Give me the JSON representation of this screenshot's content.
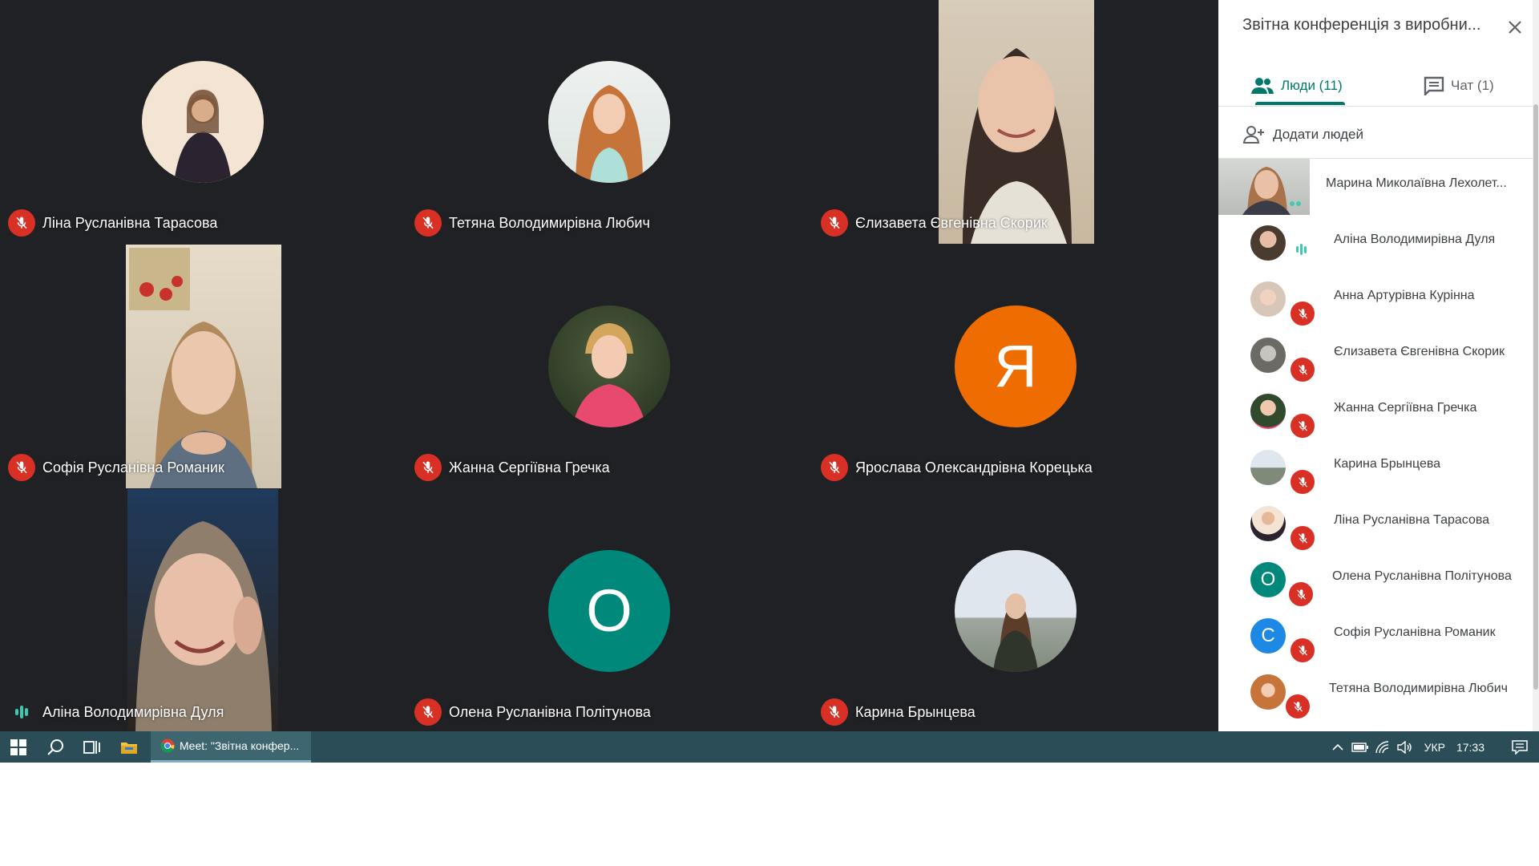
{
  "colors": {
    "meet_bg": "#202124",
    "mic_off_red": "#d93025",
    "accent_teal": "#00796b",
    "speaking_teal": "#3ec9b0",
    "avatar_orange": "#ef6c00",
    "avatar_green": "#00897b",
    "avatar_blue": "#1e88e5",
    "taskbar": "#2a4d57"
  },
  "tiles": [
    {
      "name": "Ліна Русланівна Тарасова",
      "mic": "off",
      "display": "photo"
    },
    {
      "name": "Тетяна Володимирівна Любич",
      "mic": "off",
      "display": "photo"
    },
    {
      "name": "Єлизавета Євгенівна Скорик",
      "mic": "off",
      "display": "video"
    },
    {
      "name": "Софія Русланівна Романик",
      "mic": "off",
      "display": "video"
    },
    {
      "name": "Жанна Сергіївна Гречка",
      "mic": "off",
      "display": "photo"
    },
    {
      "name": "Ярослава Олександрівна Корецька",
      "mic": "off",
      "display": "letter",
      "letter": "Я"
    },
    {
      "name": "Аліна Володимирівна Дуля",
      "mic": "speaking",
      "display": "video"
    },
    {
      "name": "Олена Русланівна Політунова",
      "mic": "off",
      "display": "letter",
      "letter": "О"
    },
    {
      "name": "Карина Брынцева",
      "mic": "off",
      "display": "photo"
    }
  ],
  "panel": {
    "title": "Звітна конференція з виробни...",
    "close_icon": "close-icon",
    "tabs": [
      {
        "label": "Люди (11)",
        "icon": "people-icon",
        "active": true
      },
      {
        "label": "Чат (1)",
        "icon": "chat-icon",
        "active": false
      }
    ],
    "add_people_label": "Додати людей",
    "participants": [
      {
        "name": "Марина Миколаївна Лехолет...",
        "status": "presenting-video"
      },
      {
        "name": "Аліна Володимирівна Дуля",
        "status": "speaking"
      },
      {
        "name": "Анна Артурівна Курінна",
        "status": "muted"
      },
      {
        "name": "Єлизавета Євгенівна Скорик",
        "status": "muted"
      },
      {
        "name": "Жанна Сергіївна Гречка",
        "status": "muted"
      },
      {
        "name": "Карина Брынцева",
        "status": "muted"
      },
      {
        "name": "Ліна Русланівна Тарасова",
        "status": "muted"
      },
      {
        "name": "Олена Русланівна Політунова",
        "status": "muted",
        "letter": "О"
      },
      {
        "name": "Софія Русланівна Романик",
        "status": "muted",
        "letter": "С"
      },
      {
        "name": "Тетяна Володимирівна Любич",
        "status": "muted"
      }
    ]
  },
  "taskbar": {
    "start_icon": "windows-start-icon",
    "search_icon": "search-icon",
    "taskview_icon": "task-view-icon",
    "explorer_icon": "file-explorer-icon",
    "chrome_window_label": "Meet: \"Звітна конфер...",
    "language": "УКР",
    "time": "17:33"
  }
}
